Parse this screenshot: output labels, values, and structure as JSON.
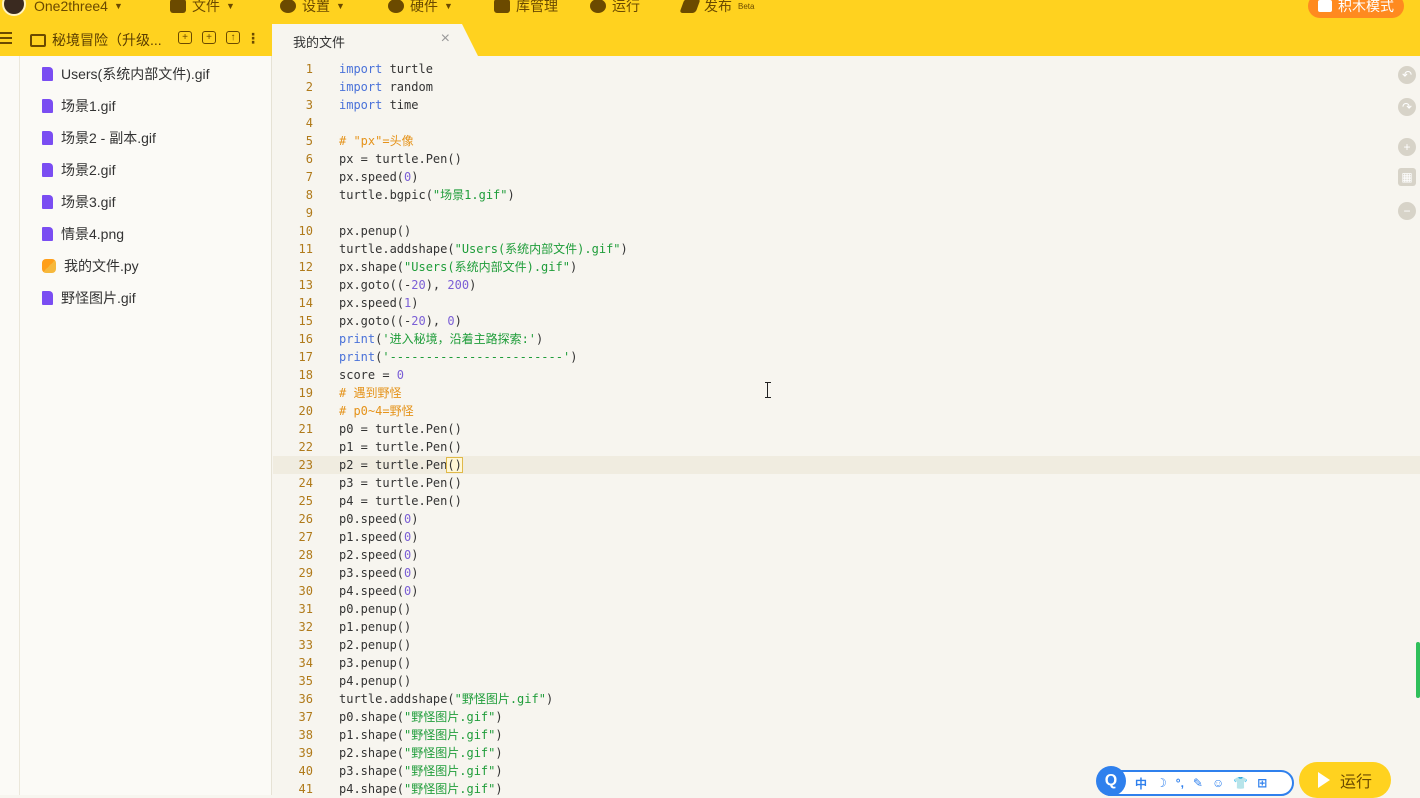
{
  "topbar": {
    "user_name": "One2three4",
    "menu": [
      {
        "label": "文件",
        "icon": "folder-icon"
      },
      {
        "label": "设置",
        "icon": "gear-icon"
      },
      {
        "label": "硬件",
        "icon": "robot-icon"
      },
      {
        "label": "库管理",
        "icon": "library-icon"
      },
      {
        "label": "运行",
        "icon": "play-icon"
      },
      {
        "label": "发布",
        "icon": "send-icon",
        "badge": "Beta"
      }
    ],
    "blocks_mode_label": "积木模式"
  },
  "project": {
    "title": "秘境冒险（升级...",
    "tab_label": "我的文件"
  },
  "files": [
    {
      "name": "Users(系统内部文件).gif",
      "type": "file"
    },
    {
      "name": "场景1.gif",
      "type": "file"
    },
    {
      "name": "场景2 - 副本.gif",
      "type": "file"
    },
    {
      "name": "场景2.gif",
      "type": "file"
    },
    {
      "name": "场景3.gif",
      "type": "file"
    },
    {
      "name": "情景4.png",
      "type": "file"
    },
    {
      "name": "我的文件.py",
      "type": "python"
    },
    {
      "name": "野怪图片.gif",
      "type": "file"
    }
  ],
  "code_lines": [
    "import turtle",
    "import random",
    "import time",
    "",
    "# \"px\"=头像",
    "px = turtle.Pen()",
    "px.speed(0)",
    "turtle.bgpic(\"场景1.gif\")",
    "",
    "px.penup()",
    "turtle.addshape(\"Users(系统内部文件).gif\")",
    "px.shape(\"Users(系统内部文件).gif\")",
    "px.goto((-20), 200)",
    "px.speed(1)",
    "px.goto((-20), 0)",
    "print('进入秘境，沿着主路探索:')",
    "print('------------------------')",
    "score = 0",
    "# 遇到野怪",
    "# p0~4=野怪",
    "p0 = turtle.Pen()",
    "p1 = turtle.Pen()",
    "p2 = turtle.Pen()",
    "p3 = turtle.Pen()",
    "p4 = turtle.Pen()",
    "p0.speed(0)",
    "p1.speed(0)",
    "p2.speed(0)",
    "p3.speed(0)",
    "p4.speed(0)",
    "p0.penup()",
    "p1.penup()",
    "p2.penup()",
    "p3.penup()",
    "p4.penup()",
    "turtle.addshape(\"野怪图片.gif\")",
    "p0.shape(\"野怪图片.gif\")",
    "p1.shape(\"野怪图片.gif\")",
    "p2.shape(\"野怪图片.gif\")",
    "p3.shape(\"野怪图片.gif\")",
    "p4.shape(\"野怪图片.gif\")"
  ],
  "active_line": 23,
  "ime": {
    "logo": "Q",
    "items": [
      "中",
      "☽",
      "°,",
      "✎",
      "☺",
      "👕",
      "⊞"
    ]
  },
  "run_button_label": "运行",
  "colors": {
    "accent": "#ffd21f",
    "keyword": "#4a72d9",
    "string": "#1f9d3a",
    "number": "#7b5fd6",
    "comment": "#e5931a"
  }
}
